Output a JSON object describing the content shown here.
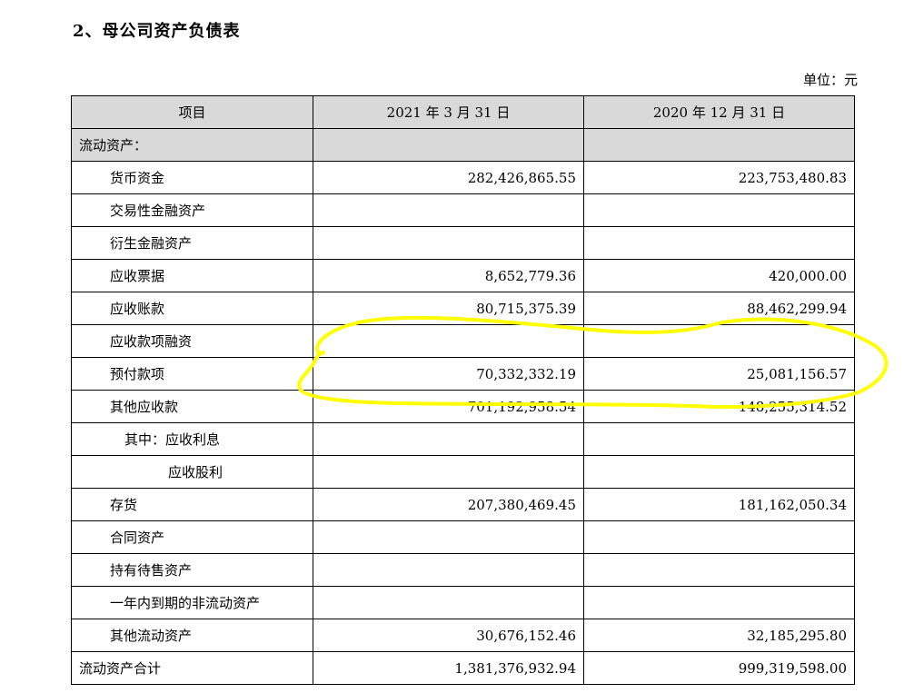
{
  "heading": "2、母公司资产负债表",
  "unit": "单位：元",
  "columns": [
    "项目",
    "2021 年 3 月 31 日",
    "2020 年 12 月 31 日"
  ],
  "rows": [
    {
      "label": "流动资产：",
      "v1": "",
      "v2": "",
      "section": true
    },
    {
      "label": "货币资金",
      "v1": "282,426,865.55",
      "v2": "223,753,480.83"
    },
    {
      "label": "交易性金融资产",
      "v1": "",
      "v2": ""
    },
    {
      "label": "衍生金融资产",
      "v1": "",
      "v2": ""
    },
    {
      "label": "应收票据",
      "v1": "8,652,779.36",
      "v2": "420,000.00"
    },
    {
      "label": "应收账款",
      "v1": "80,715,375.39",
      "v2": "88,462,299.94"
    },
    {
      "label": "应收款项融资",
      "v1": "",
      "v2": ""
    },
    {
      "label": "预付款项",
      "v1": "70,332,332.19",
      "v2": "25,081,156.57"
    },
    {
      "label": "其他应收款",
      "v1": "701,192,958.54",
      "v2": "148,255,314.52"
    },
    {
      "label": "其中：应收利息",
      "v1": "",
      "v2": ""
    },
    {
      "label": "应收股利",
      "v1": "",
      "v2": ""
    },
    {
      "label": "存货",
      "v1": "207,380,469.45",
      "v2": "181,162,050.34"
    },
    {
      "label": "合同资产",
      "v1": "",
      "v2": ""
    },
    {
      "label": "持有待售资产",
      "v1": "",
      "v2": ""
    },
    {
      "label": "一年内到期的非流动资产",
      "v1": "",
      "v2": ""
    },
    {
      "label": "其他流动资产",
      "v1": "30,676,152.46",
      "v2": "32,185,295.80"
    },
    {
      "label": "流动资产合计",
      "v1": "1,381,376,932.94",
      "v2": "999,319,598.00"
    }
  ],
  "colors": {
    "header_fill": "#d9d9d9",
    "border": "#000000",
    "highlight_stroke": "#ffff00"
  }
}
